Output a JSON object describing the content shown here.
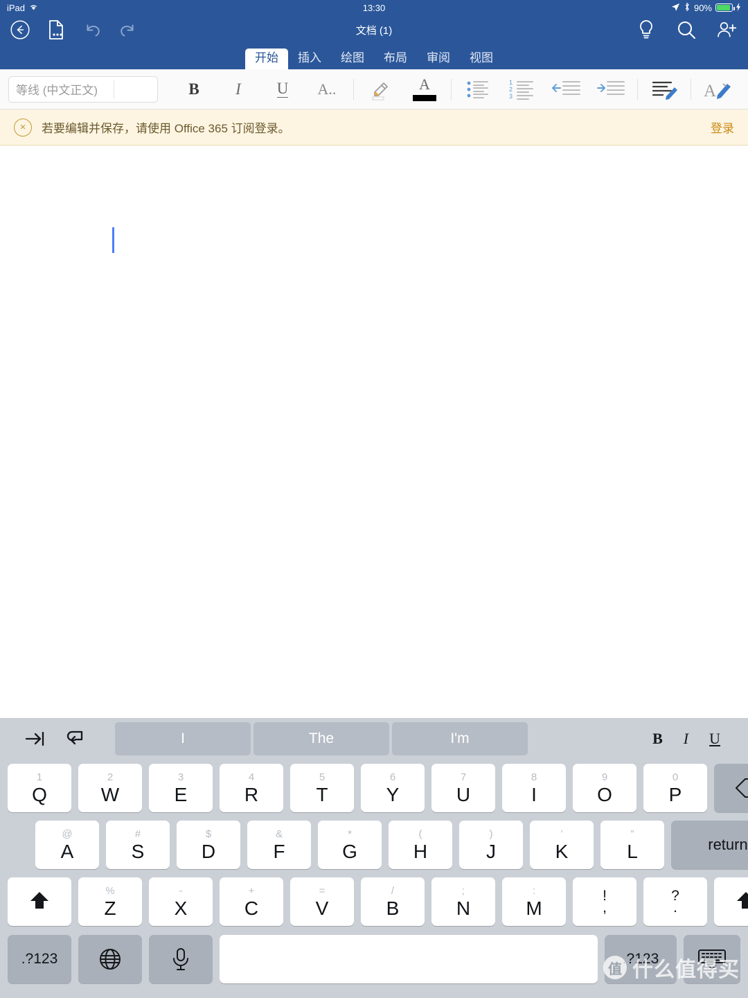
{
  "status_bar": {
    "device": "iPad",
    "wifi_icon": "wifi-icon",
    "time": "13:30",
    "location_icon": "location-arrow-icon",
    "bluetooth_icon": "bluetooth-icon",
    "battery_percent": "90%",
    "battery_level": 90,
    "battery_color": "#4cd964",
    "charging_icon": "lightning-bolt-icon"
  },
  "nav_bar": {
    "back_label": "back-icon",
    "file_label": "file-menu-icon",
    "undo_label": "undo-icon",
    "redo_label": "redo-icon",
    "title": "文档 (1)",
    "tellme_label": "lightbulb-icon",
    "search_label": "search-icon",
    "share_label": "add-person-icon",
    "background_color": "#2b579a"
  },
  "ribbon_tabs": {
    "items": [
      {
        "label": "开始",
        "active": true
      },
      {
        "label": "插入",
        "active": false
      },
      {
        "label": "绘图",
        "active": false
      },
      {
        "label": "布局",
        "active": false
      },
      {
        "label": "审阅",
        "active": false
      },
      {
        "label": "视图",
        "active": false
      }
    ]
  },
  "toolbar": {
    "font_name": "等线 (中文正文)",
    "font_size": "",
    "bold_label": "B",
    "italic_label": "I",
    "underline_label": "U",
    "font_effects_label": "A..",
    "highlight_label": "highlight-icon",
    "font_color_label": "font-color-icon",
    "font_color_swatch": "#000000",
    "bullets_label": "bulleted-list-icon",
    "numbering_label": "numbered-list-icon",
    "decrease_indent_label": "decrease-indent-icon",
    "increase_indent_label": "increase-indent-icon",
    "paragraph_format_label": "paragraph-formatting-icon",
    "format_painter_label": "text-style-brush-icon",
    "accent_color": "#4a86c8"
  },
  "banner": {
    "close_label": "×",
    "message": "若要编辑并保存，请使用 Office 365 订阅登录。",
    "action_label": "登录",
    "background_color": "#fdf5e2",
    "text_color": "#6b5a2e",
    "link_color": "#c98a14"
  },
  "document": {
    "content": "",
    "caret_visible": true,
    "caret_color": "#4a7dfc"
  },
  "keyboard": {
    "suggestion_bar": {
      "tab_icon": "tab-key-icon",
      "undo_icon": "keyboard-undo-icon",
      "suggestions": [
        "I",
        "The",
        "I'm"
      ],
      "bold_label": "B",
      "italic_label": "I",
      "underline_label": "U"
    },
    "row1": [
      {
        "alt": "1",
        "main": "Q"
      },
      {
        "alt": "2",
        "main": "W"
      },
      {
        "alt": "3",
        "main": "E"
      },
      {
        "alt": "4",
        "main": "R"
      },
      {
        "alt": "5",
        "main": "T"
      },
      {
        "alt": "6",
        "main": "Y"
      },
      {
        "alt": "7",
        "main": "U"
      },
      {
        "alt": "8",
        "main": "I"
      },
      {
        "alt": "9",
        "main": "O"
      },
      {
        "alt": "0",
        "main": "P"
      }
    ],
    "backspace_label": "backspace-icon",
    "row2": [
      {
        "alt": "@",
        "main": "A"
      },
      {
        "alt": "#",
        "main": "S"
      },
      {
        "alt": "$",
        "main": "D"
      },
      {
        "alt": "&",
        "main": "F"
      },
      {
        "alt": "*",
        "main": "G"
      },
      {
        "alt": "(",
        "main": "H"
      },
      {
        "alt": ")",
        "main": "J"
      },
      {
        "alt": "’",
        "main": "K"
      },
      {
        "alt": "”",
        "main": "L"
      }
    ],
    "return_label": "return",
    "row3": [
      {
        "alt": "%",
        "main": "Z"
      },
      {
        "alt": "-",
        "main": "X"
      },
      {
        "alt": "+",
        "main": "C"
      },
      {
        "alt": "=",
        "main": "V"
      },
      {
        "alt": "/",
        "main": "B"
      },
      {
        "alt": ";",
        "main": "N"
      },
      {
        "alt": ":",
        "main": "M"
      },
      {
        "alt": "!",
        "main": ","
      },
      {
        "alt": "?",
        "main": "."
      }
    ],
    "shift_left_label": "shift-icon",
    "shift_right_label": "shift-icon",
    "row4": {
      "numbers_left_label": ".?123",
      "globe_label": "globe-icon",
      "dictation_label": "microphone-icon",
      "space_label": "",
      "numbers_right_label": ".?123",
      "hide_keyboard_label": "hide-keyboard-icon"
    },
    "background_color": "#cbd0d7",
    "key_color": "#ffffff",
    "special_key_color": "#aab0ba"
  },
  "watermark": {
    "badge": "值",
    "text": "什么值得买"
  }
}
